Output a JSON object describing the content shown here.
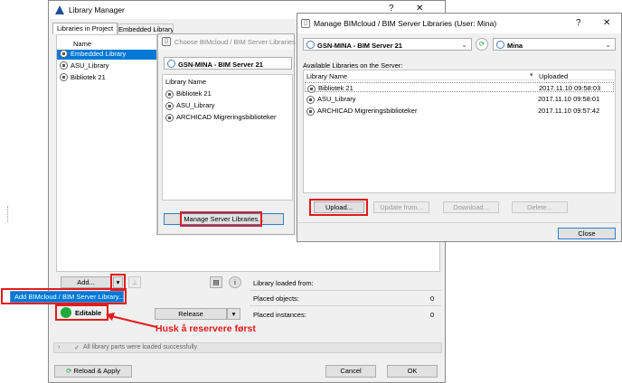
{
  "bg": {
    "grid_line": "#cfcfcf"
  },
  "library_manager": {
    "title": "Library Manager",
    "help": "?",
    "close": "✕",
    "tabs": [
      "Libraries in Project",
      "Embedded Library"
    ],
    "name_header": "Name",
    "items": [
      "Embedded Library",
      "ASU_Library",
      "Bibliotek 21"
    ],
    "add_button": "Add...",
    "dropdown_arrow": "▾",
    "add_menu_item": "Add BIMcloud / BIM Server Library...",
    "editable_label": "Editable",
    "release_button": "Release",
    "library_loaded_from": "Library loaded from:",
    "placed_objects_label": "Placed objects:",
    "placed_objects_value": "0",
    "placed_instances_label": "Placed instances:",
    "placed_instances_value": "0",
    "status_text": "All library parts were loaded successfully",
    "reload_button": "Reload & Apply",
    "cancel_button": "Cancel",
    "ok_button": "OK",
    "annotation": "Husk å reservere først",
    "accent": "#0078d7",
    "red": "#e21b1b",
    "green": "#1faa3b"
  },
  "choose_panel": {
    "title": "Choose BIMcloud / BIM Server Libraries",
    "server": "GSN-MINA - BIM Server 21",
    "header": "Library Name",
    "items": [
      "Bibliotek 21",
      "ASU_Library",
      "ARCHICAD Migreringsbiblioteker"
    ],
    "manage_button": "Manage Server Libraries..."
  },
  "manage_dialog": {
    "title": "Manage BIMcloud / BIM Server Libraries (User: Mina)",
    "help": "?",
    "close": "✕",
    "server": "GSN-MINA - BIM Server 21",
    "user": "Mina",
    "available_label": "Available Libraries on the Server:",
    "col_name": "Library Name",
    "col_uploaded": "Uploaded",
    "rows": [
      {
        "name": "Bibliotek 21",
        "uploaded": "2017.11.10 09:58:03"
      },
      {
        "name": "ASU_Library",
        "uploaded": "2017.11.10 09:58:01"
      },
      {
        "name": "ARCHICAD Migreringsbiblioteker",
        "uploaded": "2017.11.10 09:57:42"
      }
    ],
    "upload_button": "Upload...",
    "update_button": "Update from...",
    "download_button": "Download...",
    "delete_button": "Delete...",
    "close_button": "Close"
  }
}
